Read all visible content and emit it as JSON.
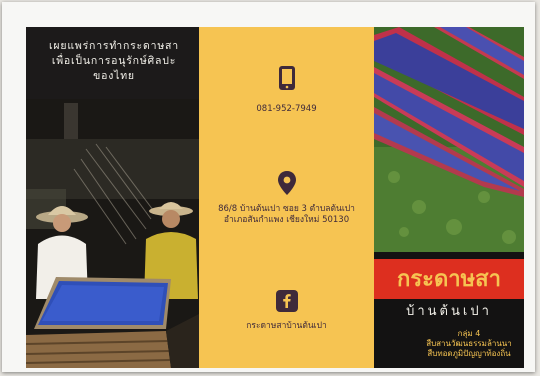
{
  "left_panel": {
    "title": "เผยแพร่การทำกระดาษสา\nเพื่อเป็นการอนุรักษ์ศิลปะ\nของไทย"
  },
  "contact": {
    "phone": "081-952-7949",
    "address": "86/8 บ้านต้นเปา ซอย 3 ตำบลต้นเปา อำเภอสันกำแพง เชียงใหม่ 50130",
    "facebook": "กระดาษสาบ้านต้นเปา",
    "phone_icon": "phone-icon",
    "location_icon": "location-pin-icon",
    "facebook_icon": "facebook-icon"
  },
  "right_panel": {
    "title": "กระดาษสา",
    "subtitle": "บ้านต้นเปา",
    "group_label": "กลุ่ม 4",
    "group_line1": "สืบสานวัฒนธรรมล้านนา",
    "group_line2": "สืบทอดภูมิปัญญาท้องถิ่น"
  },
  "colors": {
    "panel_yellow": "#f6c452",
    "panel_dark": "#1c1a1a",
    "title_red": "#dd2f1f",
    "icon_purple": "#3f2a3a"
  }
}
